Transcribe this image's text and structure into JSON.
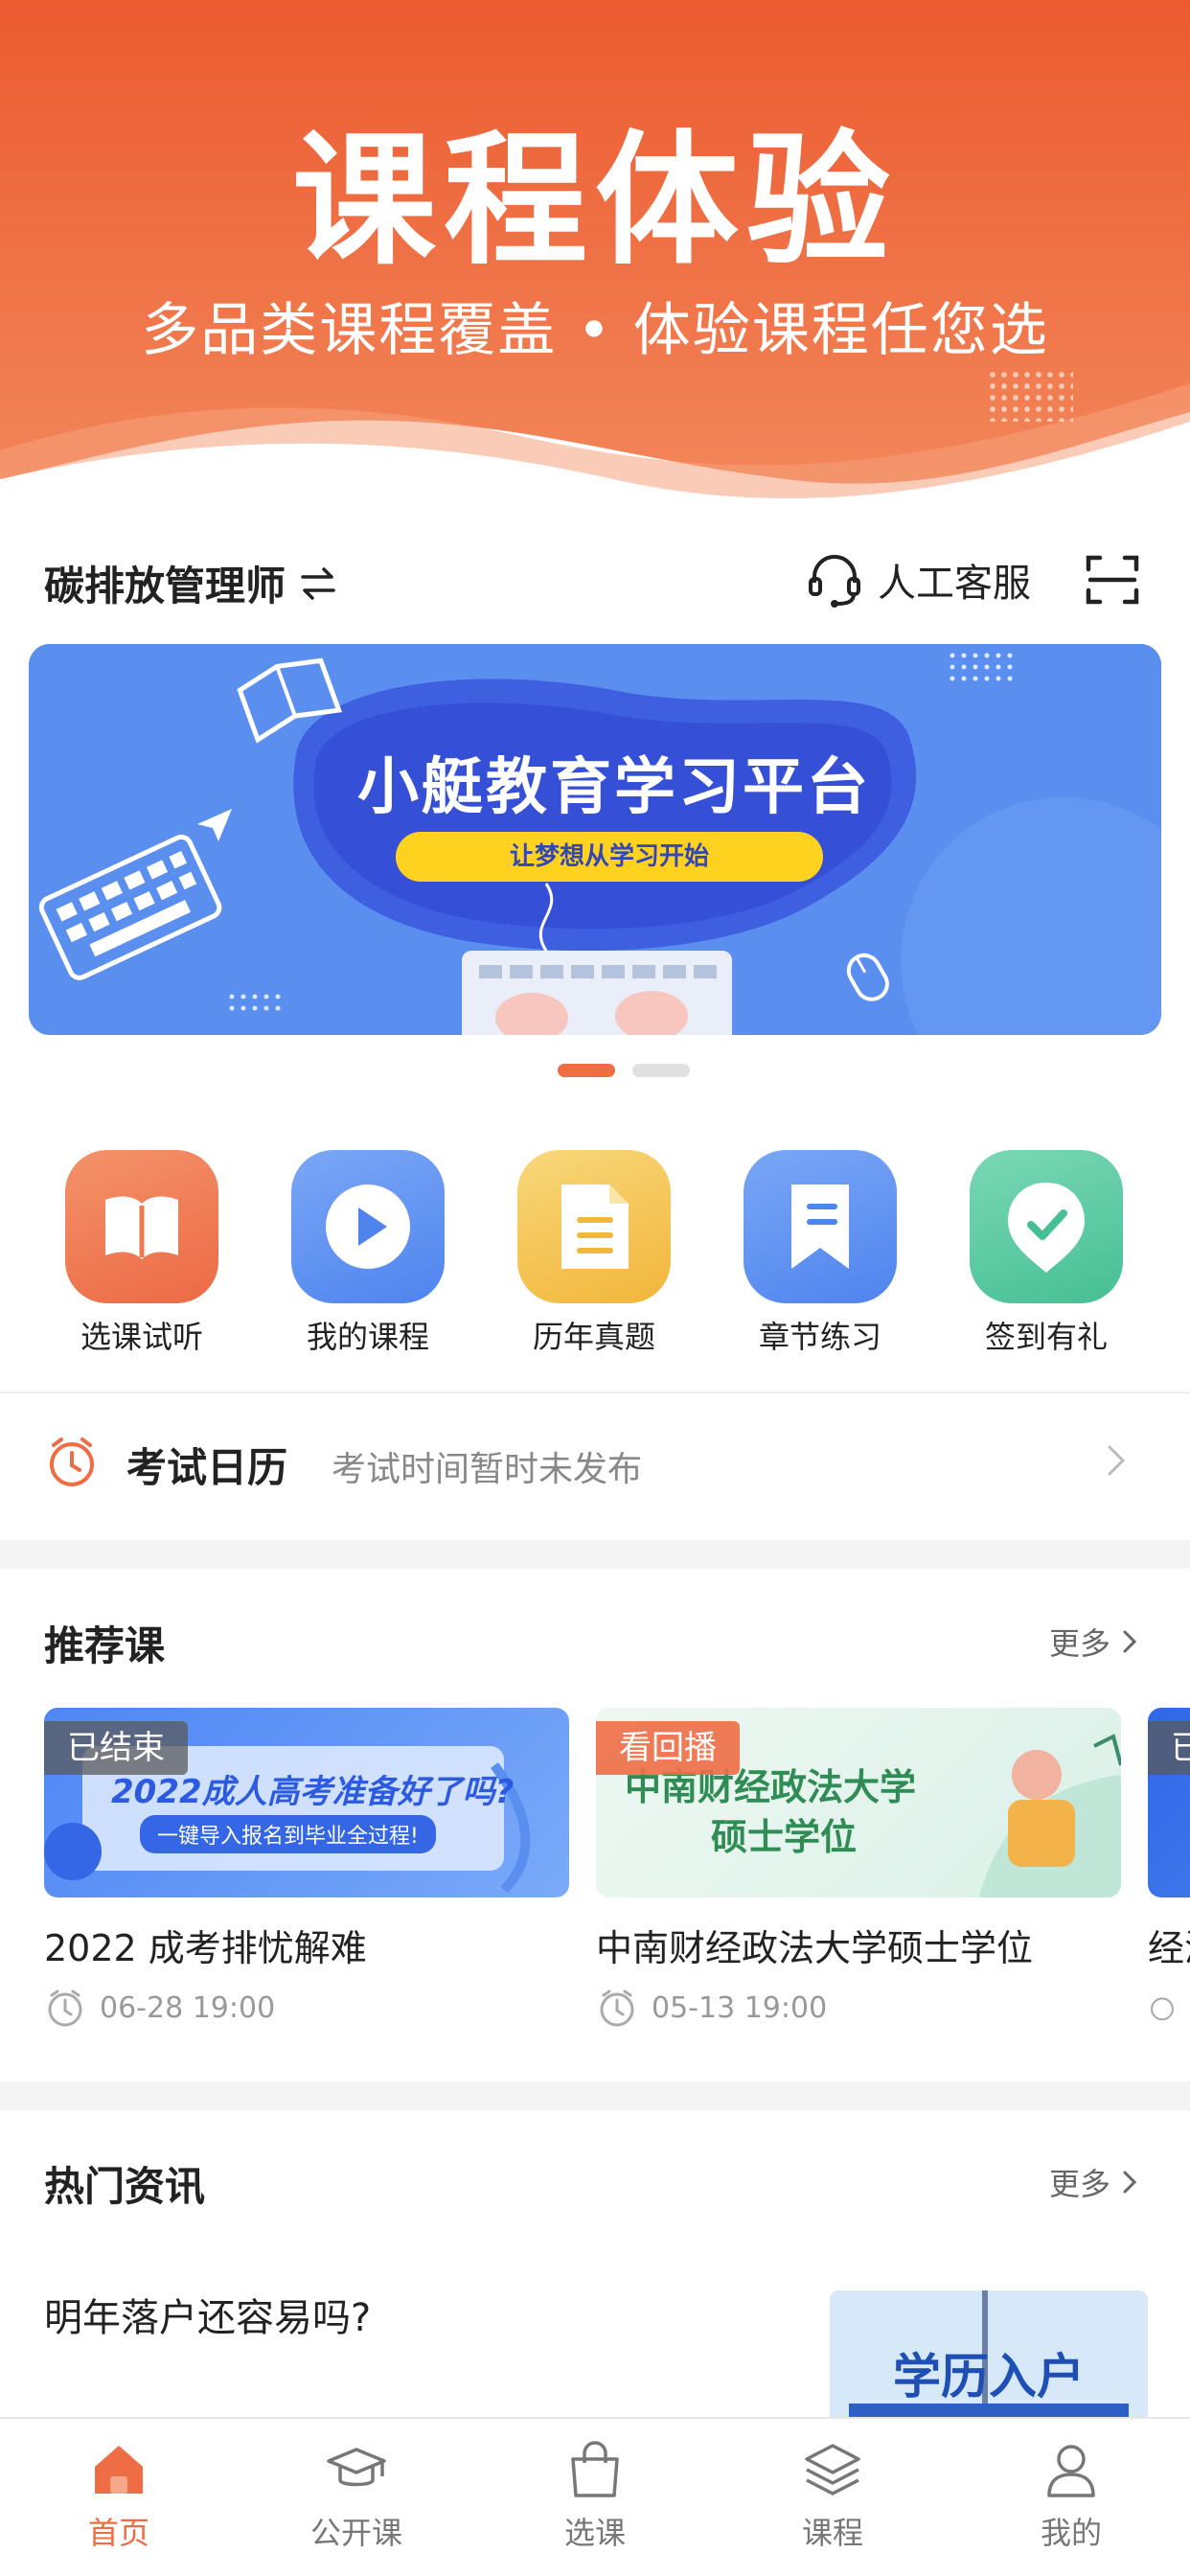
{
  "hero": {
    "title": "课程体验",
    "subtitle": "多品类课程覆盖 • 体验课程任您选"
  },
  "toolbar": {
    "major": "碳排放管理师",
    "service": "人工客服"
  },
  "banner": {
    "title": "小艇教育学习平台",
    "slogan": "让梦想从学习开始",
    "page_count": 2,
    "active_page": 1
  },
  "quick": [
    {
      "label": "选课试听",
      "icon": "book-icon",
      "color": "#ef7a4f"
    },
    {
      "label": "我的课程",
      "icon": "play-icon",
      "color": "#5b8ff0"
    },
    {
      "label": "历年真题",
      "icon": "document-icon",
      "color": "#f5c04a"
    },
    {
      "label": "章节练习",
      "icon": "bookmark-icon",
      "color": "#5b8ff0"
    },
    {
      "label": "签到有礼",
      "icon": "check-shield-icon",
      "color": "#58c9a1"
    }
  ],
  "exam": {
    "title": "考试日历",
    "status": "考试时间暂时未发布"
  },
  "recommend": {
    "title": "推荐课",
    "more": "更多",
    "courses": [
      {
        "tag": "已结束",
        "name": "2022 成考排忧解难",
        "time": "06-28 19:00",
        "thumb_title": "2022成人高考准备好了吗?",
        "thumb_sub": "一键导入报名到毕业全过程!"
      },
      {
        "tag": "看回播",
        "name": "中南财经政法大学硕士学位",
        "time": "05-13 19:00",
        "thumb_title": "中南财经政法大学",
        "thumb_sub": "硕士学位"
      },
      {
        "tag": "已",
        "name": "经济",
        "time": ""
      }
    ]
  },
  "news": {
    "title": "热门资讯",
    "more": "更多",
    "items": [
      {
        "title": "明年落户还容易吗?",
        "image_text": "学历入户"
      }
    ]
  },
  "tabbar": [
    {
      "label": "首页",
      "icon": "home-icon",
      "active": true
    },
    {
      "label": "公开课",
      "icon": "graduation-cap-icon",
      "active": false
    },
    {
      "label": "选课",
      "icon": "shopping-bag-icon",
      "active": false
    },
    {
      "label": "课程",
      "icon": "layers-icon",
      "active": false
    },
    {
      "label": "我的",
      "icon": "user-icon",
      "active": false
    }
  ],
  "colors": {
    "accent": "#ef6d45",
    "hero_top": "#ee5f35",
    "banner_bg": "#5a8ff0",
    "banner_pill": "#ffd21f"
  }
}
